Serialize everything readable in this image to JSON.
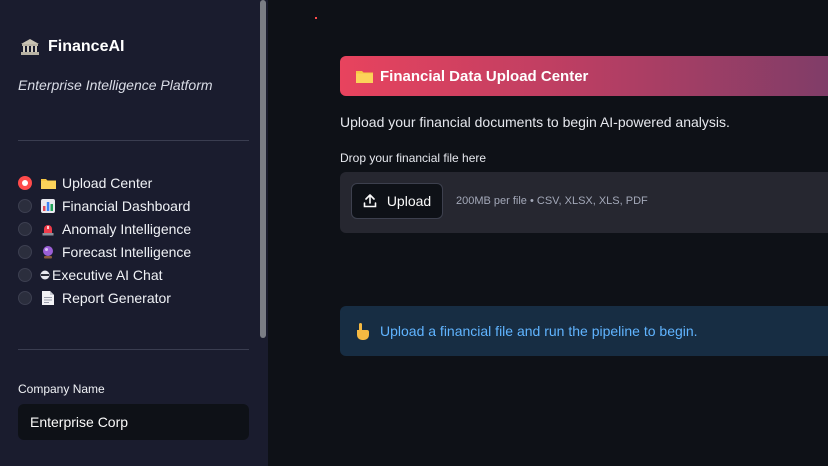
{
  "sidebar": {
    "brand": {
      "icon": "bank-icon",
      "name": "FinanceAI"
    },
    "tagline": "Enterprise Intelligence Platform",
    "nav": [
      {
        "label": "Upload Center",
        "icon": "folder-icon",
        "selected": true
      },
      {
        "label": "Financial Dashboard",
        "icon": "bar-chart-icon",
        "selected": false
      },
      {
        "label": "Anomaly Intelligence",
        "icon": "siren-icon",
        "selected": false
      },
      {
        "label": "Forecast Intelligence",
        "icon": "crystal-ball-icon",
        "selected": false
      },
      {
        "label": "Executive AI Chat",
        "icon": "helmet-icon",
        "selected": false
      },
      {
        "label": "Report Generator",
        "icon": "document-icon",
        "selected": false
      }
    ],
    "company_label": "Company Name",
    "company_value": "Enterprise Corp"
  },
  "main": {
    "banner_title": "Financial Data Upload Center",
    "banner_icon": "folder-icon",
    "intro": "Upload your financial documents to begin AI-powered analysis.",
    "drop_label": "Drop your financial file here",
    "upload_button": "Upload",
    "upload_limits": "200MB per file • CSV, XLSX, XLS, PDF",
    "info_icon": "pointing-hand-icon",
    "info_message": "Upload a financial file and run the pipeline to begin."
  },
  "colors": {
    "accent": "#ff4b4b",
    "sidebar_bg": "#1a1c2e",
    "main_bg": "#0e1117",
    "info_text": "#60b4ff",
    "info_bg": "#172d43"
  }
}
